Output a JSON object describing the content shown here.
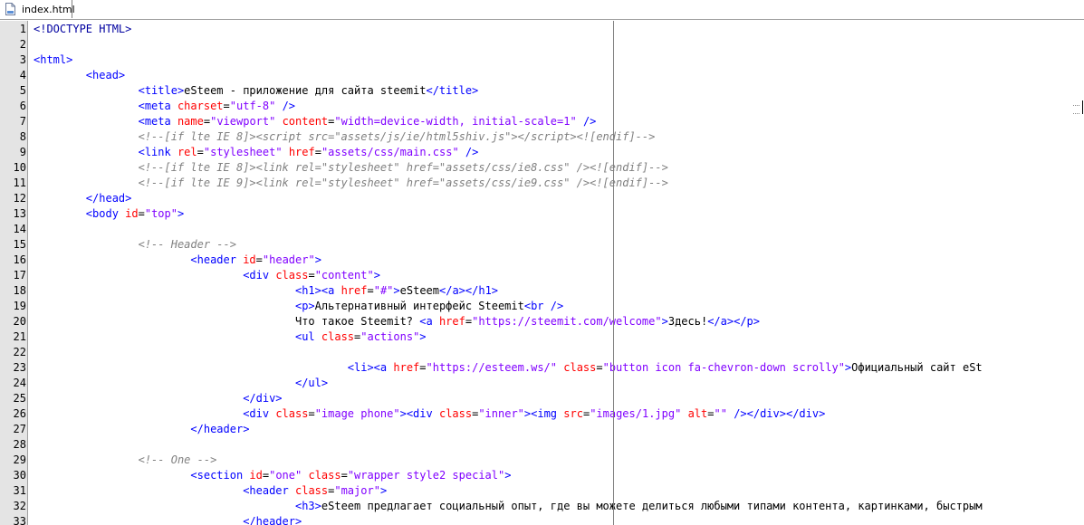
{
  "tab": {
    "filename": "index.html",
    "icon": "html-file-icon"
  },
  "lines": [
    {
      "n": "1",
      "html": "<span class=\"d\">&lt;!DOCTYPE HTML&gt;</span>"
    },
    {
      "n": "2",
      "html": ""
    },
    {
      "n": "3",
      "html": "<span class=\"t\">&lt;html&gt;</span>"
    },
    {
      "n": "4",
      "html": "        <span class=\"t\">&lt;head&gt;</span>"
    },
    {
      "n": "5",
      "html": "                <span class=\"t\">&lt;title&gt;</span>eSteem - приложение для сайта steemit<span class=\"t\">&lt;/title&gt;</span>"
    },
    {
      "n": "6",
      "html": "                <span class=\"t\">&lt;meta</span> <span class=\"a\">charset</span><span class=\"x\">=</span><span class=\"v\">\"utf-8\"</span> <span class=\"t\">/&gt;</span>"
    },
    {
      "n": "7",
      "html": "                <span class=\"t\">&lt;meta</span> <span class=\"a\">name</span>=<span class=\"v\">\"viewport\"</span> <span class=\"a\">content</span>=<span class=\"v\">\"width=device-width, initial-scale=1\"</span> <span class=\"t\">/&gt;</span>"
    },
    {
      "n": "8",
      "html": "                <span class=\"c\">&lt;!--[if lte IE 8]&gt;&lt;script src=\"assets/js/ie/html5shiv.js\"&gt;&lt;/script&gt;&lt;![endif]--&gt;</span>"
    },
    {
      "n": "9",
      "html": "                <span class=\"t\">&lt;link</span> <span class=\"a\">rel</span>=<span class=\"v\">\"stylesheet\"</span> <span class=\"a\">href</span>=<span class=\"v\">\"assets/css/main.css\"</span> <span class=\"t\">/&gt;</span>"
    },
    {
      "n": "10",
      "html": "                <span class=\"c\">&lt;!--[if lte IE 8]&gt;&lt;link rel=\"stylesheet\" href=\"assets/css/ie8.css\" /&gt;&lt;![endif]--&gt;</span>"
    },
    {
      "n": "11",
      "html": "                <span class=\"c\">&lt;!--[if lte IE 9]&gt;&lt;link rel=\"stylesheet\" href=\"assets/css/ie9.css\" /&gt;&lt;![endif]--&gt;</span>"
    },
    {
      "n": "12",
      "html": "        <span class=\"t\">&lt;/head&gt;</span>"
    },
    {
      "n": "13",
      "html": "        <span class=\"t\">&lt;body</span> <span class=\"a\">id</span>=<span class=\"v\">\"top\"</span><span class=\"t\">&gt;</span>"
    },
    {
      "n": "14",
      "html": ""
    },
    {
      "n": "15",
      "html": "                <span class=\"c\">&lt;!-- Header --&gt;</span>"
    },
    {
      "n": "16",
      "html": "                        <span class=\"t\">&lt;header</span> <span class=\"a\">id</span>=<span class=\"v\">\"header\"</span><span class=\"t\">&gt;</span>"
    },
    {
      "n": "17",
      "html": "                                <span class=\"t\">&lt;div</span> <span class=\"a\">class</span>=<span class=\"v\">\"content\"</span><span class=\"t\">&gt;</span>"
    },
    {
      "n": "18",
      "html": "                                        <span class=\"t\">&lt;h1&gt;&lt;a</span> <span class=\"a\">href</span>=<span class=\"v\">\"#\"</span><span class=\"t\">&gt;</span>eSteem<span class=\"t\">&lt;/a&gt;&lt;/h1&gt;</span>"
    },
    {
      "n": "19",
      "html": "                                        <span class=\"t\">&lt;p&gt;</span>Альтернативный интерфейс Steemit<span class=\"t\">&lt;br /&gt;</span>"
    },
    {
      "n": "20",
      "html": "                                        Что такое Steemit? <span class=\"t\">&lt;a</span> <span class=\"a\">href</span>=<span class=\"v\">\"https://steemit.com/welcome\"</span><span class=\"t\">&gt;</span>Здесь!<span class=\"t\">&lt;/a&gt;&lt;/p&gt;</span>"
    },
    {
      "n": "21",
      "html": "                                        <span class=\"t\">&lt;ul</span> <span class=\"a\">class</span>=<span class=\"v\">\"actions\"</span><span class=\"t\">&gt;</span>"
    },
    {
      "n": "22",
      "html": ""
    },
    {
      "n": "23",
      "html": "                                                <span class=\"t\">&lt;li&gt;&lt;a</span> <span class=\"a\">href</span>=<span class=\"v\">\"https://esteem.ws/\"</span> <span class=\"a\">class</span>=<span class=\"v\">\"button icon fa-chevron-down scrolly\"</span><span class=\"t\">&gt;</span>Официальный сайт eSt"
    },
    {
      "n": "24",
      "html": "                                        <span class=\"t\">&lt;/ul&gt;</span>"
    },
    {
      "n": "25",
      "html": "                                <span class=\"t\">&lt;/div&gt;</span>"
    },
    {
      "n": "26",
      "html": "                                <span class=\"t\">&lt;div</span> <span class=\"a\">class</span>=<span class=\"v\">\"image phone\"</span><span class=\"t\">&gt;&lt;div</span> <span class=\"a\">class</span>=<span class=\"v\">\"inner\"</span><span class=\"t\">&gt;&lt;img</span> <span class=\"a\">src</span>=<span class=\"v\">\"images/1.jpg\"</span> <span class=\"a\">alt</span>=<span class=\"v\">\"\"</span> <span class=\"t\">/&gt;&lt;/div&gt;&lt;/div&gt;</span>"
    },
    {
      "n": "27",
      "html": "                        <span class=\"t\">&lt;/header&gt;</span>"
    },
    {
      "n": "28",
      "html": ""
    },
    {
      "n": "29",
      "html": "                <span class=\"c\">&lt;!-- One --&gt;</span>"
    },
    {
      "n": "30",
      "html": "                        <span class=\"t\">&lt;section</span> <span class=\"a\">id</span>=<span class=\"v\">\"one\"</span> <span class=\"a\">class</span>=<span class=\"v\">\"wrapper style2 special\"</span><span class=\"t\">&gt;</span>"
    },
    {
      "n": "31",
      "html": "                                <span class=\"t\">&lt;header</span> <span class=\"a\">class</span>=<span class=\"v\">\"major\"</span><span class=\"t\">&gt;</span>"
    },
    {
      "n": "32",
      "html": "                                        <span class=\"t\">&lt;h3&gt;</span>eSteem предлагает социальный опыт, где вы можете делиться любыми типами контента, картинками, быстрым"
    },
    {
      "n": "33",
      "html": "                                <span class=\"t\">&lt;/header&gt;</span>"
    }
  ]
}
